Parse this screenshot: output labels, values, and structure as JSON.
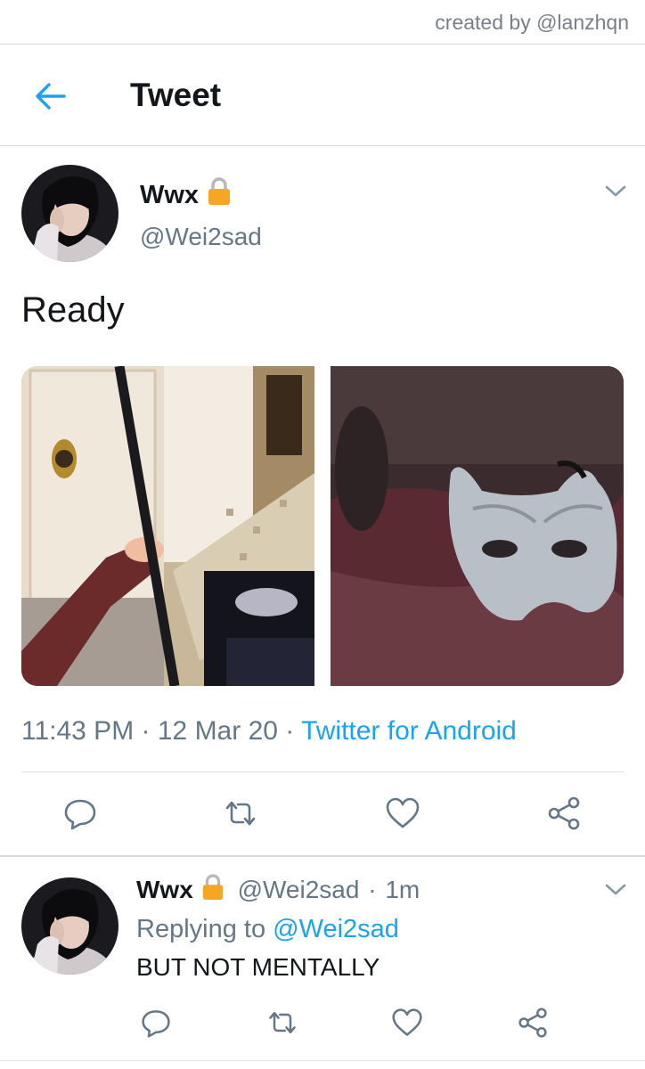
{
  "credit": "created by @lanzhqn",
  "header": {
    "title": "Tweet",
    "back_icon": "back-arrow-icon"
  },
  "tweet": {
    "name": "Wwx",
    "handle": "@Wei2sad",
    "text": "Ready",
    "time": "11:43 PM",
    "date": "12 Mar 20",
    "source": "Twitter for Android",
    "media": [
      "photo-holding-sword-at-door",
      "photo-mask-on-carpet"
    ],
    "actions": [
      "reply-icon",
      "retweet-icon",
      "like-icon",
      "share-icon"
    ]
  },
  "reply": {
    "name": "Wwx",
    "handle": "@Wei2sad",
    "age": "1m",
    "replying_label": "Replying to",
    "replying_to": "@Wei2sad",
    "text": "BUT NOT MENTALLY",
    "actions": [
      "reply-icon",
      "retweet-icon",
      "like-icon",
      "share-icon"
    ]
  },
  "colors": {
    "accent": "#1da1f2",
    "secondary_text": "#657786",
    "lock": "#f5a623"
  }
}
